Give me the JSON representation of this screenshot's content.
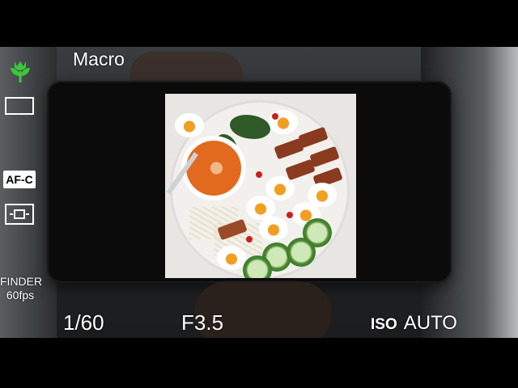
{
  "osd": {
    "mode": "Macro",
    "focus_mode": "AF-C",
    "finder_line1": "FINDER",
    "finder_line2": "60fps",
    "shutter": "1/60",
    "aperture": "F3.5",
    "iso_label": "ISO",
    "iso_value": "AUTO",
    "icons": [
      "macro-tulip-icon",
      "aspect-ratio-icon",
      "af-area-icon"
    ],
    "macro_icon_color": "#3cc83c"
  }
}
